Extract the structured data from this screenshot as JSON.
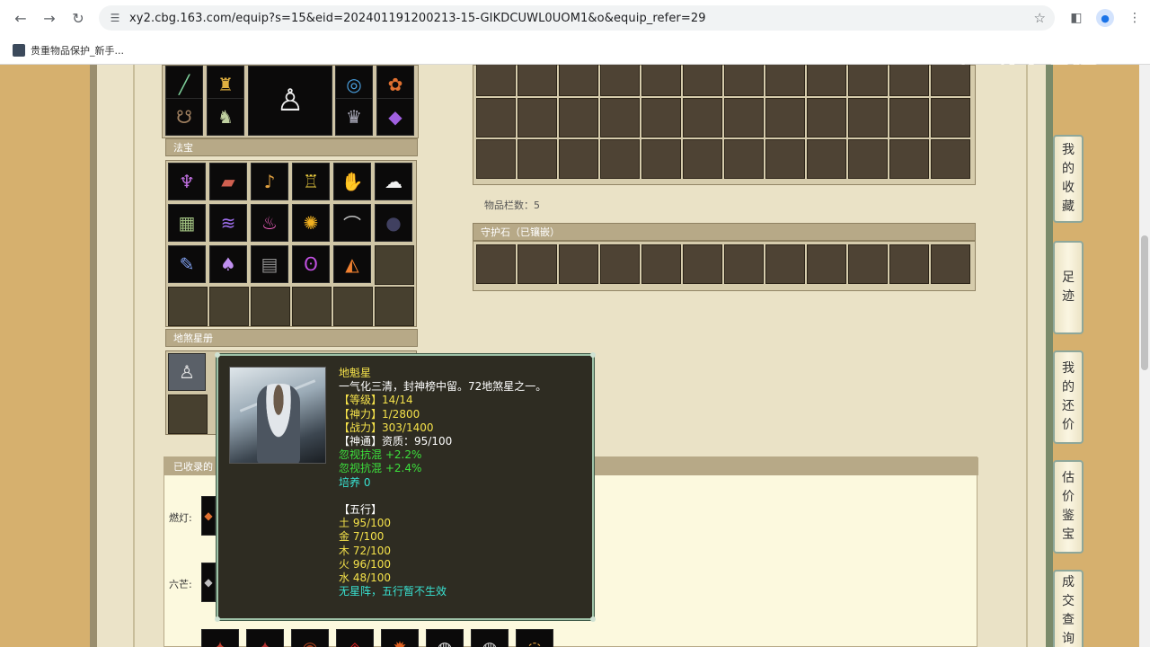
{
  "browser": {
    "url": "xy2.cbg.163.com/equip?s=15&eid=202401191200213-15-GIKDCUWL0UOM1&o&equip_refer=29",
    "bookmark_label": "贵重物品保护_新手..."
  },
  "watermark": "CC直播",
  "sections": {
    "fabao_title": "法宝",
    "dizhao_title": "地煞星册",
    "guard_title": "守护石（已镶嵌）",
    "item_count": "物品栏数：5",
    "collected_title": "已收录的"
  },
  "collected_rows": [
    "燃灯:",
    "六芒:"
  ],
  "tooltip": {
    "name": "地魁星",
    "desc": "一气化三清，封神榜中留。72地煞星之一。",
    "level": "【等级】14/14",
    "shenli": "【神力】1/2800",
    "zhanli": "【战力】303/1400",
    "shentong": "【神通】资质：95/100",
    "attr1": "忽视抗混 +2.2%",
    "attr2": "忽视抗混 +2.4%",
    "peiyang": "培养 0",
    "wuxing_title": "【五行】",
    "wuxing": [
      "土 95/100",
      "金 7/100",
      "木 72/100",
      "火 96/100",
      "水 48/100"
    ],
    "note": "无星阵，五行暂不生效"
  },
  "sidebar": [
    {
      "label": "我的收藏",
      "chars": [
        "我",
        "的",
        "收",
        "藏"
      ]
    },
    {
      "label": "足迹",
      "chars": [
        "足",
        "迹"
      ]
    },
    {
      "label": "我的还价",
      "chars": [
        "我",
        "的",
        "还",
        "价"
      ]
    },
    {
      "label": "估价鉴宝",
      "chars": [
        "估",
        "价",
        "鉴",
        "宝"
      ]
    },
    {
      "label": "成交查询",
      "chars": [
        "成",
        "交",
        "查",
        "询"
      ]
    }
  ],
  "colors": {
    "tooltip_bg": "#2e2c22",
    "yellow": "#f5e24a",
    "green": "#3ce03c",
    "cyan": "#38e0d0"
  }
}
